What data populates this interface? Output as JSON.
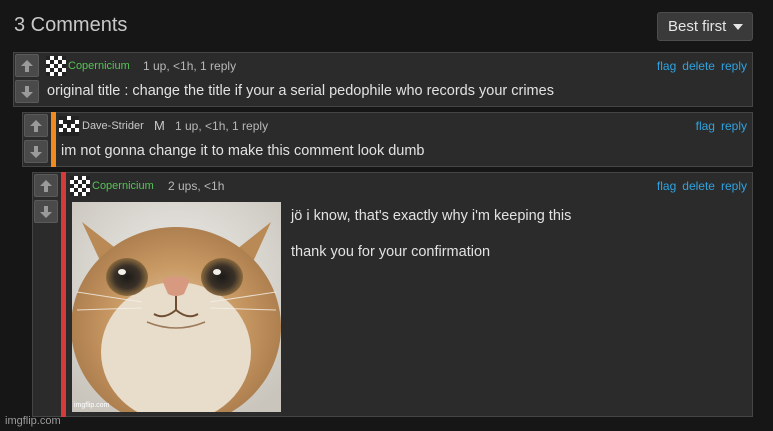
{
  "header": {
    "title": "3 Comments",
    "sort_label": "Best first"
  },
  "comments": [
    {
      "author": "Copernicium",
      "author_color": "#56c456",
      "meta": "1 up, <1h, 1 reply",
      "actions": [
        "flag",
        "delete",
        "reply"
      ],
      "text": "original title : change the title if your a serial pedophile who records your crimes"
    },
    {
      "author": "Dave-Strider",
      "author_color": "#c8c8c8",
      "badge": "M",
      "meta": "1 up, <1h, 1 reply",
      "actions": [
        "flag",
        "reply"
      ],
      "text": "im not gonna change it to make this comment look dumb",
      "accent_color": "#f08c1e"
    },
    {
      "author": "Copernicium",
      "author_color": "#56c456",
      "meta": "2 ups, <1h",
      "actions": [
        "flag",
        "delete",
        "reply"
      ],
      "text_lines": [
        "jö i know, that's exactly why i'm keeping this",
        "thank you for your confirmation"
      ],
      "accent_color": "#d83a3a",
      "image_watermark": "imgflip.com"
    }
  ],
  "footer": {
    "watermark": "imgflip.com"
  },
  "colors": {
    "link": "#2fa3e0",
    "background": "#161616",
    "panel": "#2b2b2b"
  }
}
